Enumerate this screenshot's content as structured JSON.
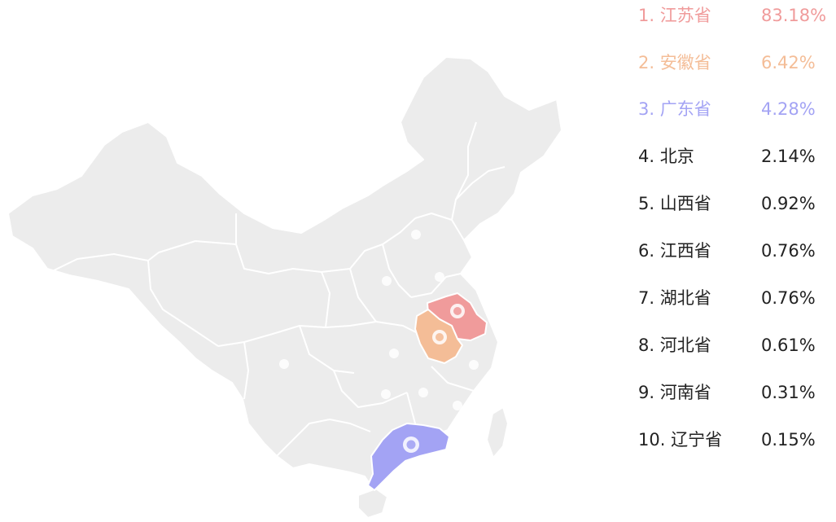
{
  "map": {
    "base_color": "#ececec",
    "border_color": "#ffffff",
    "highlighted": [
      {
        "province": "江苏省",
        "color": "#f09b9b"
      },
      {
        "province": "安徽省",
        "color": "#f4bd97"
      },
      {
        "province": "广东省",
        "color": "#a3a3f4"
      }
    ],
    "markers": [
      "江苏省",
      "安徽省",
      "广东省",
      "北京",
      "山西省",
      "江西省",
      "湖北省",
      "河北省",
      "河南省",
      "辽宁省"
    ]
  },
  "ranking": [
    {
      "label": "1. 江苏省",
      "value": "83.18%",
      "color": "#f09b9b"
    },
    {
      "label": "2. 安徽省",
      "value": "6.42%",
      "color": "#f4bd97"
    },
    {
      "label": "3. 广东省",
      "value": "4.28%",
      "color": "#a3a3f4"
    },
    {
      "label": "4. 北京",
      "value": "2.14%",
      "color": "#222222"
    },
    {
      "label": "5. 山西省",
      "value": "0.92%",
      "color": "#222222"
    },
    {
      "label": "6. 江西省",
      "value": "0.76%",
      "color": "#222222"
    },
    {
      "label": "7. 湖北省",
      "value": "0.76%",
      "color": "#222222"
    },
    {
      "label": "8. 河北省",
      "value": "0.61%",
      "color": "#222222"
    },
    {
      "label": "9. 河南省",
      "value": "0.31%",
      "color": "#222222"
    },
    {
      "label": "10. 辽宁省",
      "value": "0.15%",
      "color": "#222222"
    }
  ]
}
